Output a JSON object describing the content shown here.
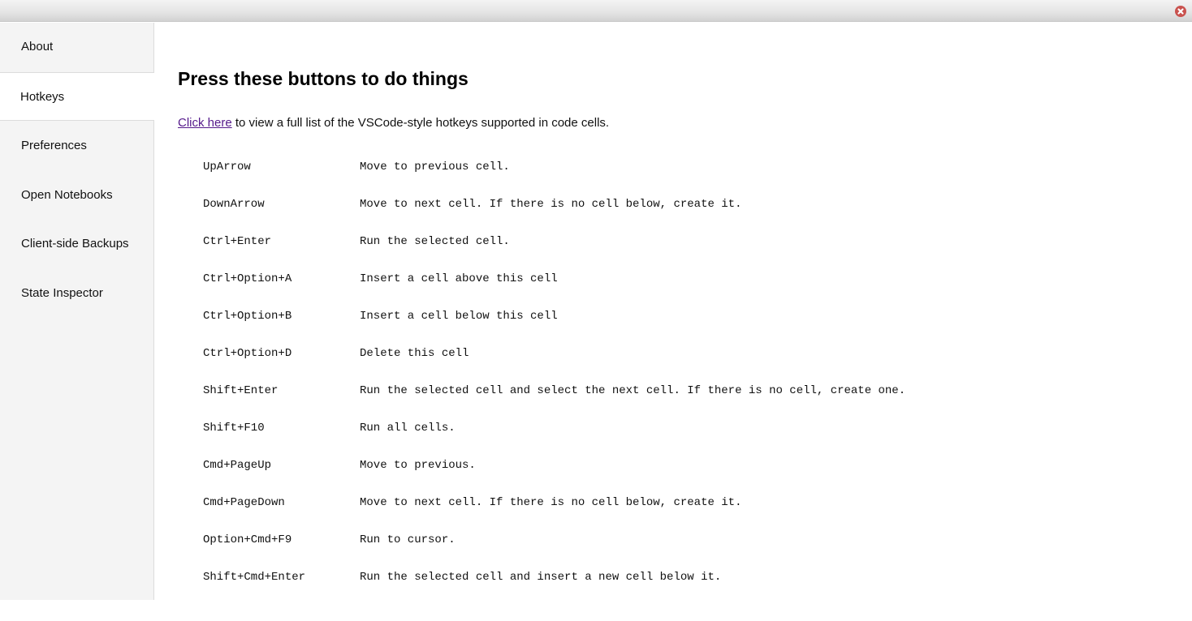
{
  "window": {
    "close_icon": "close-icon",
    "close_color": "#c9524e"
  },
  "sidebar": {
    "items": [
      {
        "label": "About",
        "active": false
      },
      {
        "label": "Hotkeys",
        "active": true
      },
      {
        "label": "Preferences",
        "active": false
      },
      {
        "label": "Open Notebooks",
        "active": false
      },
      {
        "label": "Client-side Backups",
        "active": false
      },
      {
        "label": "State Inspector",
        "active": false
      }
    ]
  },
  "main": {
    "title": "Press these buttons to do things",
    "intro_link": "Click here",
    "intro_text": " to view a full list of the VSCode-style hotkeys supported in code cells.",
    "link_color": "#551a8b",
    "hotkeys": [
      {
        "key": "UpArrow",
        "desc": "Move to previous cell."
      },
      {
        "key": "DownArrow",
        "desc": "Move to next cell. If there is no cell below, create it."
      },
      {
        "key": "Ctrl+Enter",
        "desc": "Run the selected cell."
      },
      {
        "key": "Ctrl+Option+A",
        "desc": "Insert a cell above this cell"
      },
      {
        "key": "Ctrl+Option+B",
        "desc": "Insert a cell below this cell"
      },
      {
        "key": "Ctrl+Option+D",
        "desc": "Delete this cell"
      },
      {
        "key": "Shift+Enter",
        "desc": "Run the selected cell and select the next cell. If there is no cell, create one."
      },
      {
        "key": "Shift+F10",
        "desc": "Run all cells."
      },
      {
        "key": "Cmd+PageUp",
        "desc": "Move to previous."
      },
      {
        "key": "Cmd+PageDown",
        "desc": "Move to next cell. If there is no cell below, create it."
      },
      {
        "key": "Option+Cmd+F9",
        "desc": "Run to cursor."
      },
      {
        "key": "Shift+Cmd+Enter",
        "desc": "Run the selected cell and insert a new cell below it."
      }
    ]
  }
}
